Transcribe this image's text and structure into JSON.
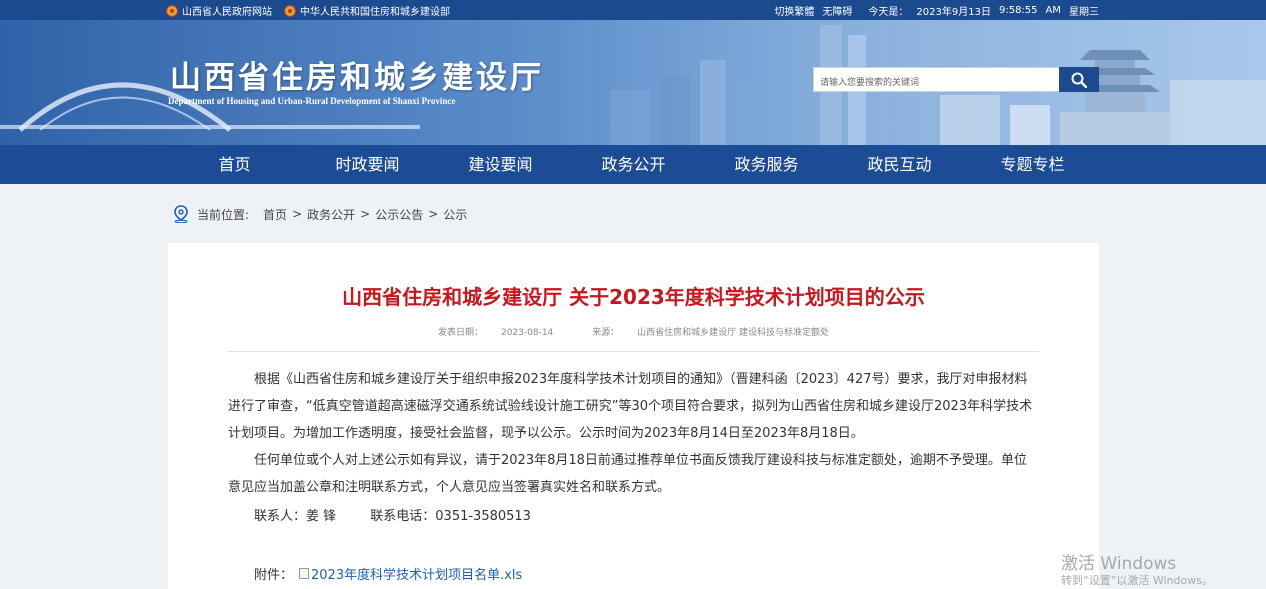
{
  "topbar": {
    "links": [
      "山西省人民政府网站",
      "中华人民共和国住房和城乡建设部"
    ],
    "switch_label": "切换繁體",
    "accessibility_label": "无障碍",
    "today_label": "今天是：",
    "date": "2023年9月13日",
    "time": "9:58:55",
    "ampm": "AM",
    "weekday": "星期三"
  },
  "header": {
    "title": "山西省住房和城乡建设厅",
    "subtitle": "Department of Housing and Urban-Rural Development of Shanxi Province",
    "search_placeholder": "请输入您要搜索的关键词",
    "search_icon": "search-icon"
  },
  "nav": {
    "items": [
      "首页",
      "时政要闻",
      "建设要闻",
      "政务公开",
      "政务服务",
      "政民互动",
      "专题专栏"
    ]
  },
  "breadcrumb": {
    "label": "当前位置:",
    "items": [
      "首页",
      "政务公开",
      "公示公告",
      "公示"
    ],
    "separator": ">"
  },
  "article": {
    "title": "山西省住房和城乡建设厅 关于2023年度科学技术计划项目的公示",
    "date_label": "发表日期：",
    "date": "2023-08-14",
    "source_label": "来源：",
    "source": "山西省住房和城乡建设厅 建设科技与标准定额处",
    "paragraph1": "根据《山西省住房和城乡建设厅关于组织申报2023年度科学技术计划项目的通知》（晋建科函〔2023〕427号）要求，我厅对申报材料进行了审查，“低真空管道超高速磁浮交通系统试验线设计施工研究”等30个项目符合要求，拟列为山西省住房和城乡建设厅2023年科学技术计划项目。为增加工作透明度，接受社会监督，现予以公示。公示时间为2023年8月14日至2023年8月18日。",
    "paragraph2": "任何单位或个人对上述公示如有异议，请于2023年8月18日前通过推荐单位书面反馈我厅建设科技与标准定额处，逾期不予受理。单位意见应当加盖公章和注明联系方式，个人意见应当签署真实姓名和联系方式。",
    "contact_person": "联系人：姜 锋",
    "contact_phone": "联系电话：0351-3580513",
    "attachment_label": "附件：",
    "attachment_name": "2023年度科学技术计划项目名单.xls"
  },
  "watermark": {
    "line1": "激活 Windows",
    "line2": "转到“设置”以激活 Windows。"
  }
}
